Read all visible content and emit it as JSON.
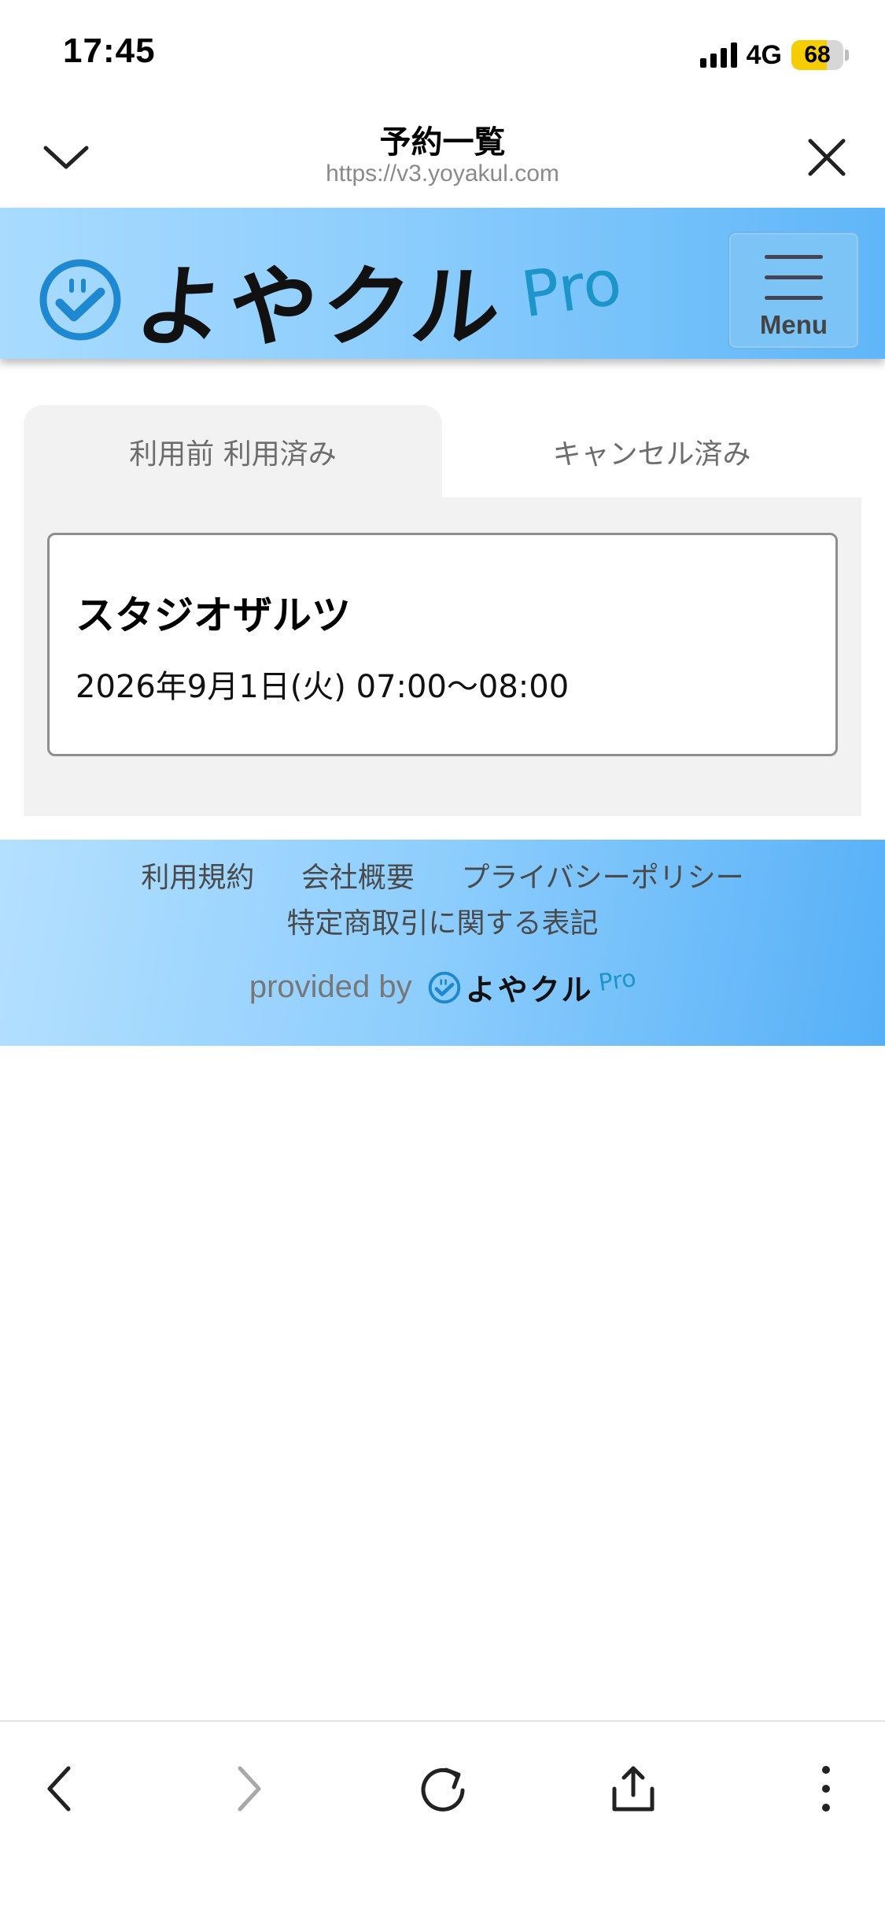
{
  "status_bar": {
    "time": "17:45",
    "network": "4G",
    "battery_level": "68",
    "battery_fraction": 0.68,
    "battery_color": "#f6cd02"
  },
  "browser": {
    "title": "予約一覧",
    "url": "https://v3.yoyakul.com",
    "collapse_icon": "chevron-down-icon",
    "close_icon": "close-icon"
  },
  "app_header": {
    "logo_text": "よやクル",
    "logo_suffix": "Pro",
    "menu_label": "Menu"
  },
  "tabs": [
    {
      "label": "利用前 利用済み",
      "active": true
    },
    {
      "label": "キャンセル済み",
      "active": false
    }
  ],
  "reservations": [
    {
      "name": "スタジオザルツ",
      "datetime": "2026年9月1日(火) 07:00〜08:00"
    }
  ],
  "footer": {
    "links_row1": [
      "利用規約",
      "会社概要",
      "プライバシーポリシー"
    ],
    "links_row2": [
      "特定商取引に関する表記"
    ],
    "provided_by": "provided by",
    "mini_logo_text": "よやクル",
    "mini_logo_suffix": "Pro"
  },
  "colors": {
    "header_gradient_start": "#a9dbff",
    "header_gradient_end": "#5fb6f8",
    "logo_icon": "#1e88d0",
    "logo_pro": "#1e95c9"
  },
  "toolbar": {
    "back_icon": "chevron-left-icon",
    "forward_icon": "chevron-right-icon",
    "reload_icon": "reload-icon",
    "share_icon": "share-icon",
    "more_icon": "more-vertical-icon"
  }
}
